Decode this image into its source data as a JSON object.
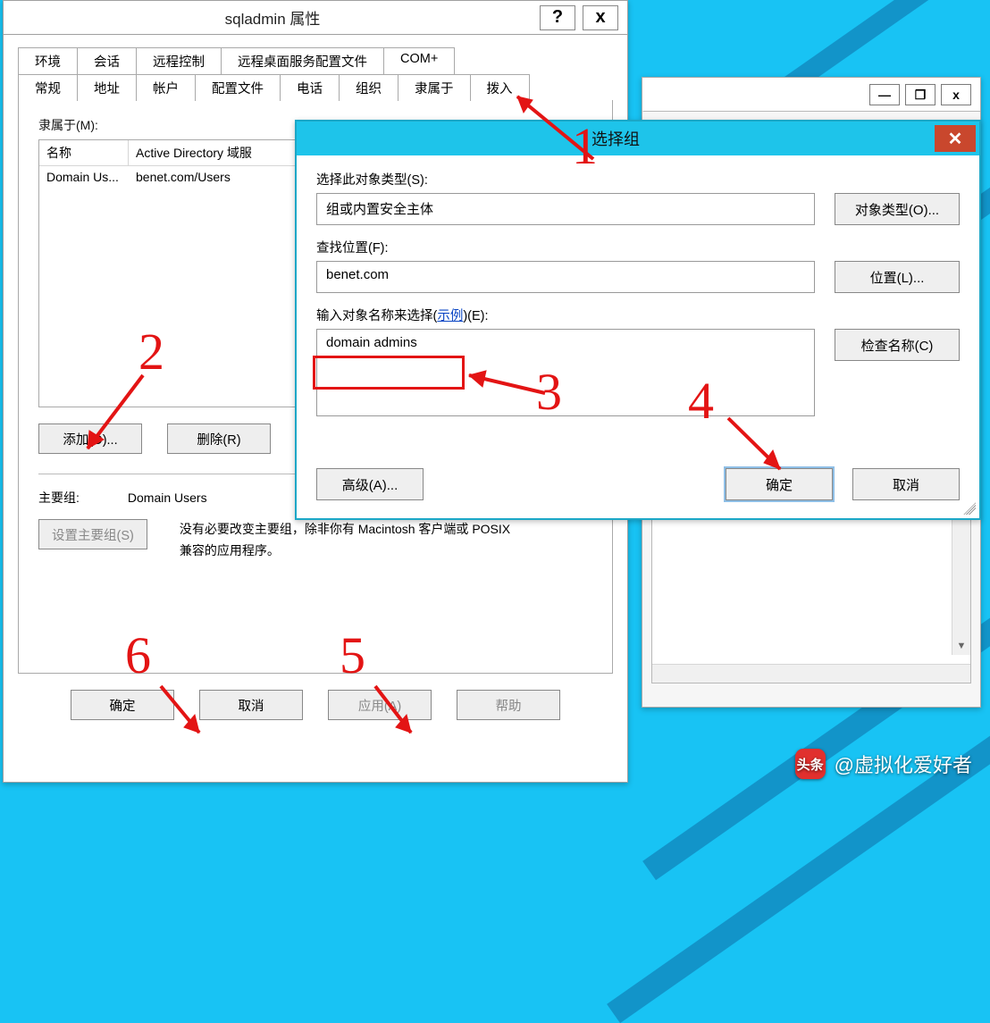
{
  "props_dialog": {
    "title": "sqladmin 属性",
    "help": "?",
    "close": "x",
    "tabs_row1": [
      "环境",
      "会话",
      "远程控制",
      "远程桌面服务配置文件",
      "COM+"
    ],
    "tabs_row2": [
      "常规",
      "地址",
      "帐户",
      "配置文件",
      "电话",
      "组织",
      "隶属于",
      "拨入"
    ],
    "active_tab": "隶属于",
    "member_of_label": "隶属于(M):",
    "list_headers": {
      "name": "名称",
      "folder": "Active Directory 域服"
    },
    "list_rows": [
      {
        "name": "Domain Us...",
        "folder": "benet.com/Users"
      }
    ],
    "add_btn": "添加(D)...",
    "remove_btn": "删除(R)",
    "primary_group_label": "主要组:",
    "primary_group_value": "Domain Users",
    "set_primary_btn": "设置主要组(S)",
    "primary_note": "没有必要改变主要组，除非你有 Macintosh 客户端或 POSIX 兼容的应用程序。",
    "ok": "确定",
    "cancel": "取消",
    "apply": "应用(A)",
    "help_btn": "帮助"
  },
  "select_dialog": {
    "title": "选择组",
    "label_type": "选择此对象类型(S):",
    "value_type": "组或内置安全主体",
    "btn_type": "对象类型(O)...",
    "label_location": "查找位置(F):",
    "value_location": "benet.com",
    "btn_location": "位置(L)...",
    "label_names_prefix": "输入对象名称来选择(",
    "label_names_link": "示例",
    "label_names_suffix": ")(E):",
    "value_names": "domain admins",
    "btn_check": "检查名称(C)",
    "btn_advanced": "高级(A)...",
    "ok": "确定",
    "cancel": "取消"
  },
  "back_window": {
    "min": "—",
    "restore": "❐",
    "close": "x"
  },
  "annotations": {
    "n1": "1",
    "n2": "2",
    "n3": "3",
    "n4": "4",
    "n5": "5",
    "n6": "6"
  },
  "watermark": {
    "logo": "头条",
    "text": "@虚拟化爱好者"
  }
}
